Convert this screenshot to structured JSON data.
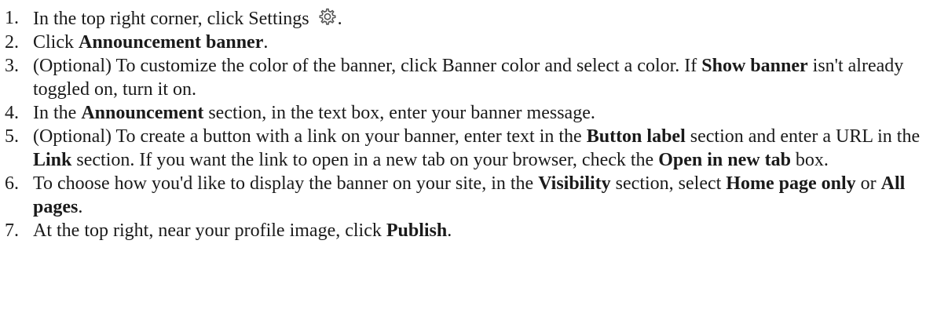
{
  "steps": [
    {
      "number": "1.",
      "parts": {
        "t1": "In the top right corner, click Settings",
        "t2": "."
      },
      "icon": "gear-icon"
    },
    {
      "number": "2.",
      "parts": {
        "t1": "Click ",
        "b1": "Announcement banner",
        "t2": "."
      }
    },
    {
      "number": "3.",
      "parts": {
        "t1": "(Optional) To customize the color of the banner, click Banner color and select a color. If ",
        "b1": "Show banner",
        "t2": " isn't already toggled on, turn it on."
      }
    },
    {
      "number": "4.",
      "parts": {
        "t1": "In the ",
        "b1": "Announcement",
        "t2": " section, in the text box, enter your banner message."
      }
    },
    {
      "number": "5.",
      "parts": {
        "t1": "(Optional) To create a button with a link on your banner, enter text in the ",
        "b1": "Button label",
        "t2": " section and enter a URL in the ",
        "b2": "Link",
        "t3": " section. If you want the link to open in a new tab on your browser, check the ",
        "b3": "Open in new tab",
        "t4": " box."
      }
    },
    {
      "number": "6.",
      "parts": {
        "t1": "To choose how you'd like to display the banner on your site, in the ",
        "b1": "Visibility",
        "t2": " section, select ",
        "b2": "Home page only",
        "t3": " or ",
        "b3": "All pages",
        "t4": "."
      }
    },
    {
      "number": "7.",
      "parts": {
        "t1": "At the top right, near your profile image, click ",
        "b1": "Publish",
        "t2": "."
      }
    }
  ]
}
